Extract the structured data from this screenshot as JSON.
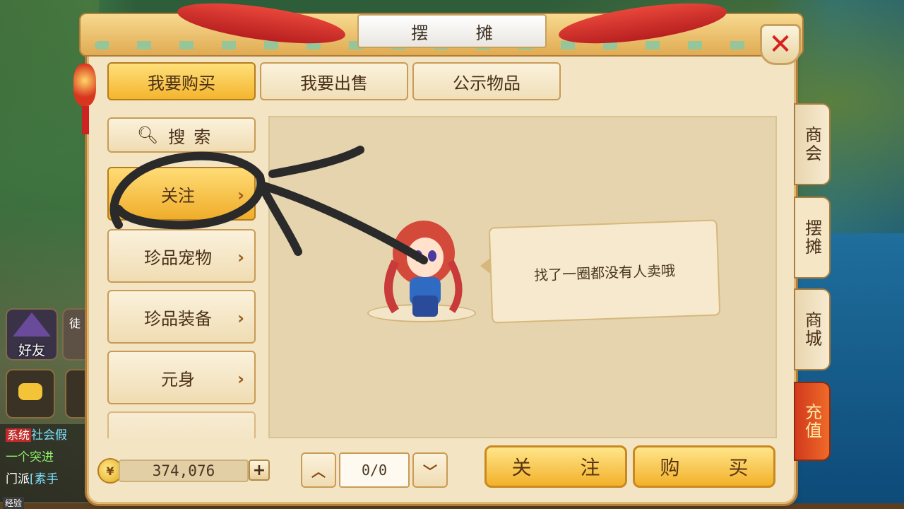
{
  "window": {
    "title": "摆 摊"
  },
  "tabs": [
    {
      "label": "我要购买",
      "active": true
    },
    {
      "label": "我要出售",
      "active": false
    },
    {
      "label": "公示物品",
      "active": false
    }
  ],
  "side_menu": {
    "search_label": "搜索",
    "items": [
      {
        "label": "关注",
        "active": true
      },
      {
        "label": "珍品宠物",
        "active": false
      },
      {
        "label": "珍品装备",
        "active": false
      },
      {
        "label": "元身",
        "active": false
      }
    ]
  },
  "content": {
    "empty_message": "找了一圈都没有人卖哦"
  },
  "currency": {
    "amount": "374,076",
    "plus_label": "+"
  },
  "pager": {
    "value": "0/0"
  },
  "actions": {
    "follow_label": "关 注",
    "buy_label": "购 买"
  },
  "right_tabs": [
    {
      "label": "商会"
    },
    {
      "label": "摆摊"
    },
    {
      "label": "商城"
    },
    {
      "label": "充值"
    }
  ],
  "hud": {
    "friends_label": "好友",
    "apprentice_label": "徒",
    "chat_lines": [
      {
        "tag": "系统",
        "text": "社会假"
      },
      {
        "tag": "",
        "text": "一个突进"
      },
      {
        "tag": "门派",
        "text": "[素手"
      }
    ],
    "exp_label": "经验"
  },
  "icons": {
    "close": "close-icon",
    "search": "magnifier-icon",
    "chevron": "chevron-right-icon",
    "page_up": "chevron-up-icon",
    "page_down": "chevron-down-icon",
    "coin": "coin-icon"
  },
  "colors": {
    "accent_gold": "#f3b12a",
    "close_red": "#d5201e",
    "panel_bg": "#f3e4c4"
  }
}
